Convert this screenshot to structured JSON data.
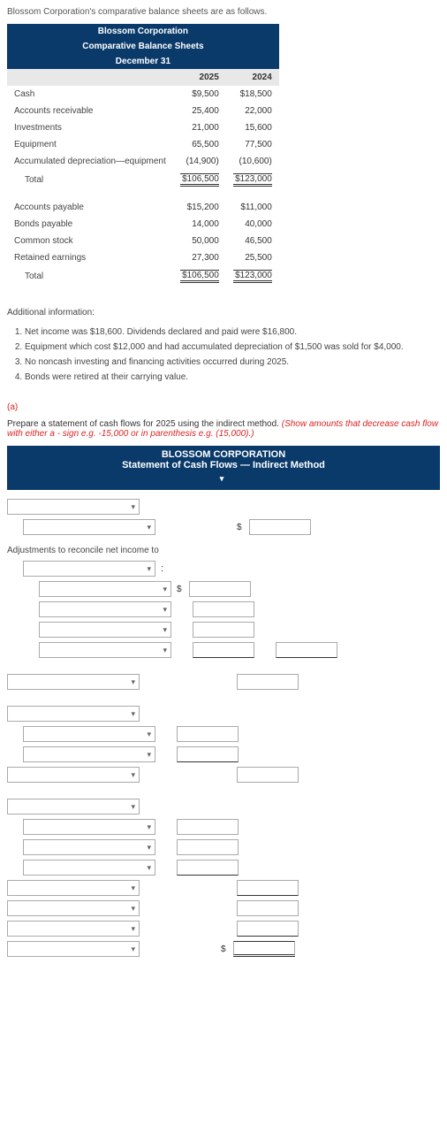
{
  "intro": "Blossom Corporation's comparative balance sheets are as follows.",
  "sheet": {
    "title1": "Blossom Corporation",
    "title2": "Comparative Balance Sheets",
    "title3": "December 31",
    "yearA": "2025",
    "yearB": "2024",
    "rows": [
      {
        "label": "Cash",
        "a": "$9,500",
        "b": "$18,500"
      },
      {
        "label": "Accounts receivable",
        "a": "25,400",
        "b": "22,000"
      },
      {
        "label": "Investments",
        "a": "21,000",
        "b": "15,600"
      },
      {
        "label": "Equipment",
        "a": "65,500",
        "b": "77,500"
      },
      {
        "label": "Accumulated depreciation—equipment",
        "a": "(14,900)",
        "b": "(10,600)"
      }
    ],
    "total1": {
      "label": "Total",
      "a": "$106,500",
      "b": "$123,000"
    },
    "rows2": [
      {
        "label": "Accounts payable",
        "a": "$15,200",
        "b": "$11,000"
      },
      {
        "label": "Bonds payable",
        "a": "14,000",
        "b": "40,000"
      },
      {
        "label": "Common stock",
        "a": "50,000",
        "b": "46,500"
      },
      {
        "label": "Retained earnings",
        "a": "27,300",
        "b": "25,500"
      }
    ],
    "total2": {
      "label": "Total",
      "a": "$106,500",
      "b": "$123,000"
    }
  },
  "addl_title": "Additional information:",
  "addl": [
    "Net income was $18,600. Dividends declared and paid were $16,800.",
    "Equipment which cost $12,000 and had accumulated depreciation of $1,500 was sold for $4,000.",
    "No noncash investing and financing activities occurred during 2025.",
    "Bonds were retired at their carrying value."
  ],
  "part": "(a)",
  "instr_main": "Prepare a statement of cash flows for 2025 using the indirect method. ",
  "instr_red": "(Show amounts that decrease cash flow with either a - sign e.g. -15,000 or in parenthesis e.g. (15,000).)",
  "stmt": {
    "h1": "BLOSSOM CORPORATION",
    "h2": "Statement of Cash Flows — Indirect Method"
  },
  "adj_label": "Adjustments to reconcile net income to",
  "dollar": "$",
  "chart_data": {
    "type": "table",
    "title": "Blossom Corporation Comparative Balance Sheets December 31",
    "columns": [
      "Account",
      "2025",
      "2024"
    ],
    "rows": [
      [
        "Cash",
        9500,
        18500
      ],
      [
        "Accounts receivable",
        25400,
        22000
      ],
      [
        "Investments",
        21000,
        15600
      ],
      [
        "Equipment",
        65500,
        77500
      ],
      [
        "Accumulated depreciation—equipment",
        -14900,
        -10600
      ],
      [
        "Total assets",
        106500,
        123000
      ],
      [
        "Accounts payable",
        15200,
        11000
      ],
      [
        "Bonds payable",
        14000,
        40000
      ],
      [
        "Common stock",
        50000,
        46500
      ],
      [
        "Retained earnings",
        27300,
        25500
      ],
      [
        "Total liab+equity",
        106500,
        123000
      ]
    ]
  }
}
